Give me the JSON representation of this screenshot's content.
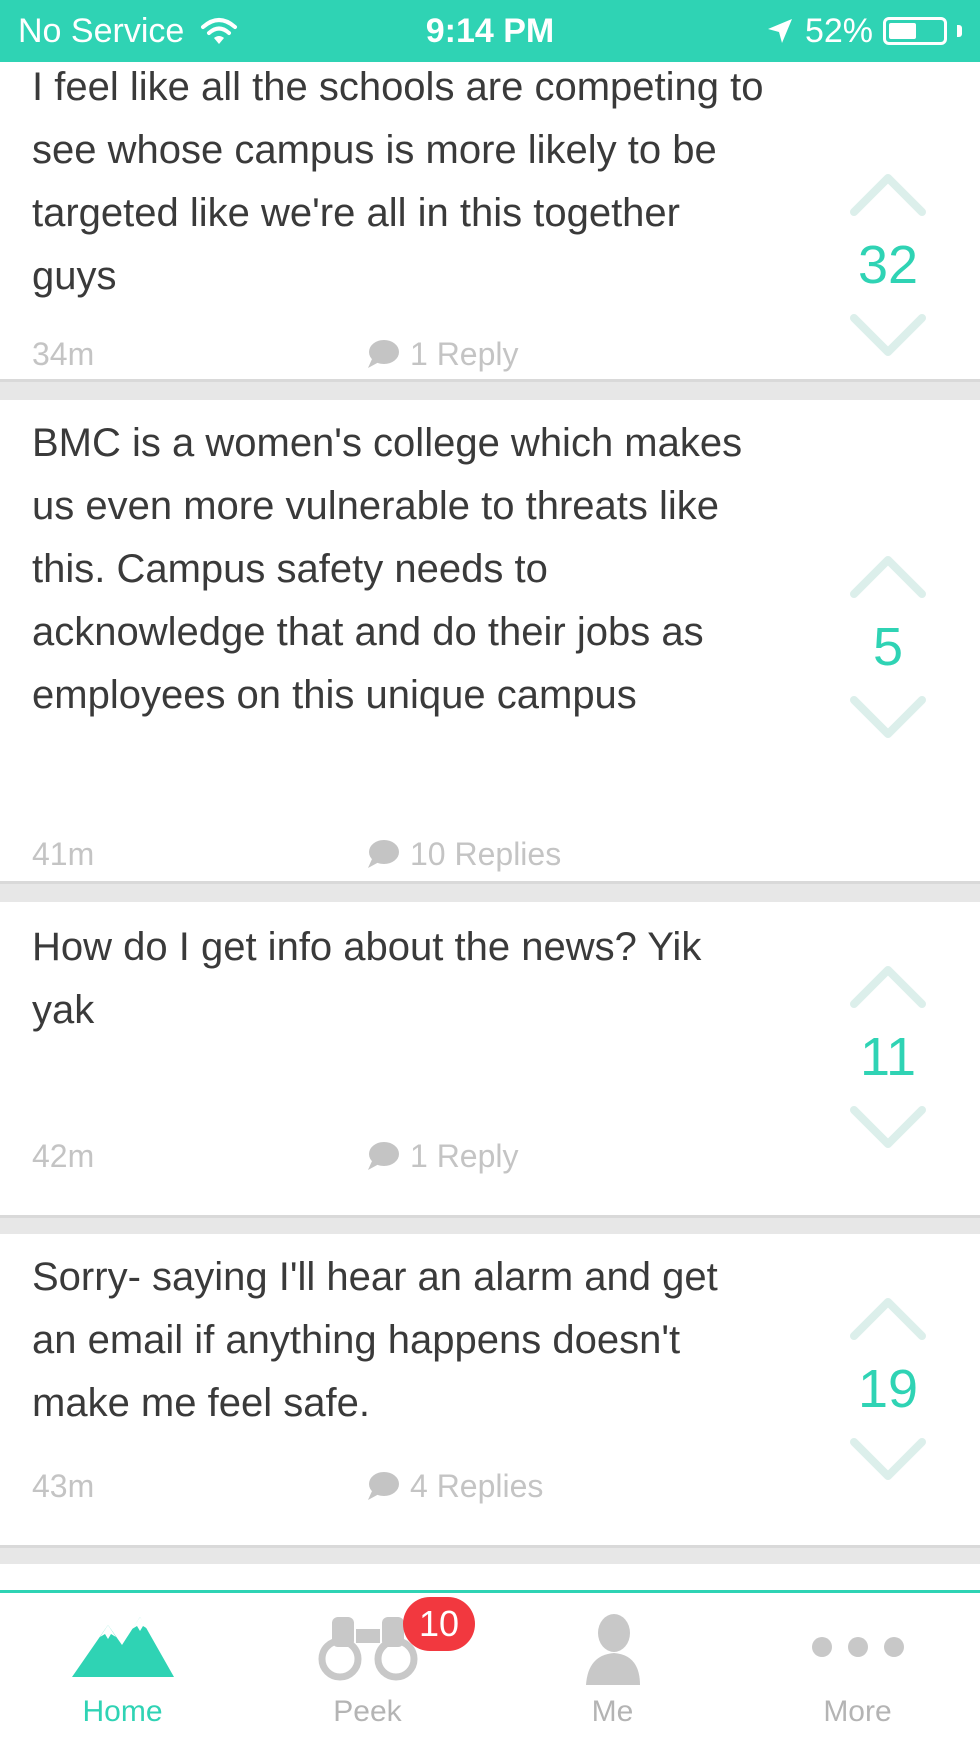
{
  "status_bar": {
    "carrier": "No Service",
    "time": "9:14 PM",
    "battery": "52%",
    "battery_level": 0.52
  },
  "posts": [
    {
      "text": "I feel like all the schools are competing to see whose campus is more likely to be targeted like we're all in this together guys",
      "time": "34m",
      "replies": "1 Reply",
      "votes": "32"
    },
    {
      "text": "BMC is a women's college which makes us even more vulnerable to threats like this. Campus safety needs to acknowledge that and do their jobs as employees on this unique campus",
      "time": "41m",
      "replies": "10 Replies",
      "votes": "5"
    },
    {
      "text": "How do I get info about the news? Yik yak",
      "time": "42m",
      "replies": "1 Reply",
      "votes": "11"
    },
    {
      "text": "Sorry- saying I'll hear an alarm and get an email if anything happens doesn't make me feel safe.",
      "time": "43m",
      "replies": "4 Replies",
      "votes": "19"
    }
  ],
  "tabs": [
    {
      "label": "Home",
      "icon": "mountain-icon",
      "active": true
    },
    {
      "label": "Peek",
      "icon": "binoculars-icon",
      "badge": "10"
    },
    {
      "label": "Me",
      "icon": "person-icon"
    },
    {
      "label": "More",
      "icon": "more-dots-icon"
    }
  ],
  "colors": {
    "accent": "#2fd3b4",
    "badge": "#f2383f",
    "text": "#3a3a3a",
    "muted": "#c4c4c4"
  }
}
